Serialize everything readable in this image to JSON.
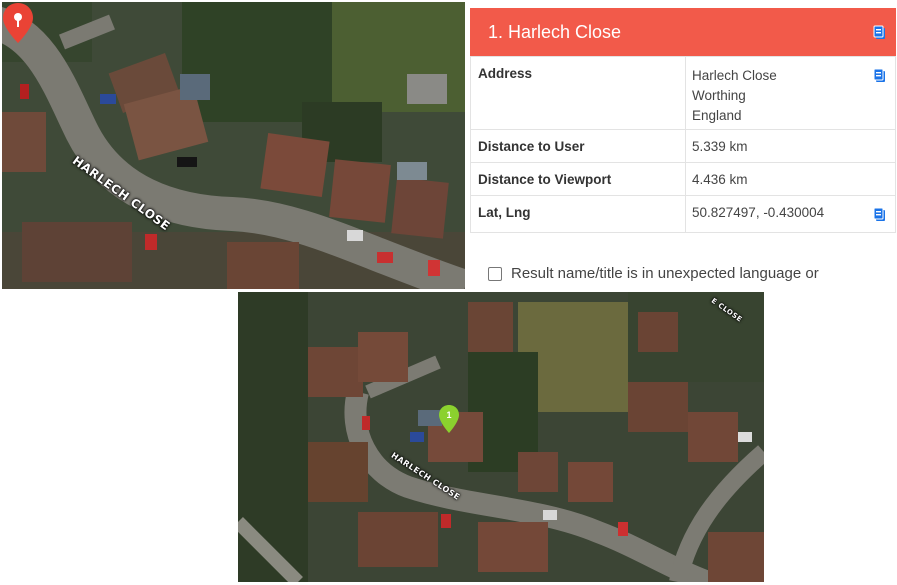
{
  "map_top": {
    "road_label": "HARLECH CLOSE",
    "pin": "red-location-pin-icon"
  },
  "map_bottom": {
    "road_label": "HARLECH CLOSE",
    "partial_label": "E CLOSE",
    "pin_number": "1",
    "pin": "green-location-pin-icon"
  },
  "result": {
    "title": "1. Harlech Close",
    "rows": [
      {
        "label": "Address",
        "lines": [
          "Harlech Close",
          "Worthing",
          "England"
        ]
      },
      {
        "label": "Distance to User",
        "value": "5.339 km"
      },
      {
        "label": "Distance to Viewport",
        "value": "4.436 km"
      },
      {
        "label": "Lat, Lng",
        "value": "50.827497, -0.430004"
      }
    ],
    "checkbox_label": "Result name/title is in unexpected language or"
  },
  "icons": {
    "copy": "clipboard-copy-icon"
  },
  "colors": {
    "header": "#f25a4a",
    "copy_icon": "#1a73e8",
    "pin_red": "#ea4335",
    "pin_green": "#8bd12e"
  }
}
